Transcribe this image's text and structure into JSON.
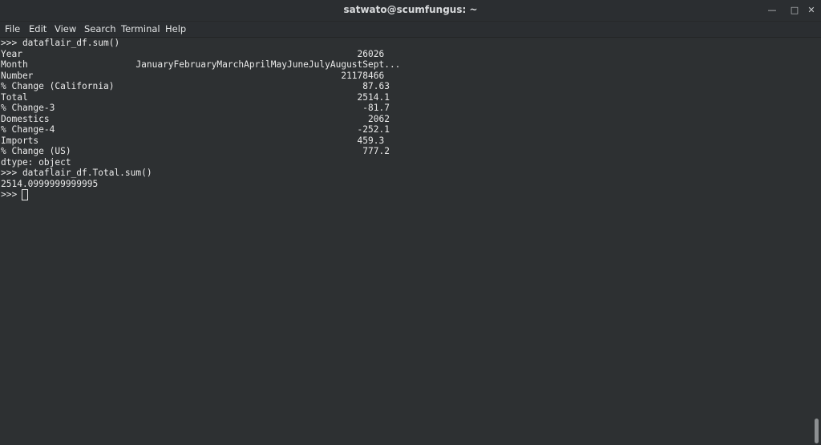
{
  "window": {
    "title": "satwato@scumfungus: ~",
    "controls": {
      "minimize": "—",
      "maximize": "□",
      "close": "✕"
    }
  },
  "menu": {
    "file": "File",
    "edit": "Edit",
    "view": "View",
    "search": "Search",
    "terminal": "Terminal",
    "help": "Help"
  },
  "terminal": {
    "lines": [
      ">>> dataflair_df.sum()",
      "Year                                                              26026",
      "Month                    JanuaryFebruaryMarchAprilMayJuneJulyAugustSept...",
      "Number                                                         21178466",
      "% Change (California)                                              87.63",
      "Total                                                             2514.1",
      "% Change-3                                                         -81.7",
      "Domestics                                                           2062",
      "% Change-4                                                        -252.1",
      "Imports                                                           459.3",
      "% Change (US)                                                      777.2",
      "dtype: object",
      ">>> dataflair_df.Total.sum()",
      "2514.0999999999995",
      ">>> "
    ]
  },
  "colors": {
    "background": "#2d3032",
    "text": "#eaeaea",
    "chrome": "#2b2e31"
  }
}
